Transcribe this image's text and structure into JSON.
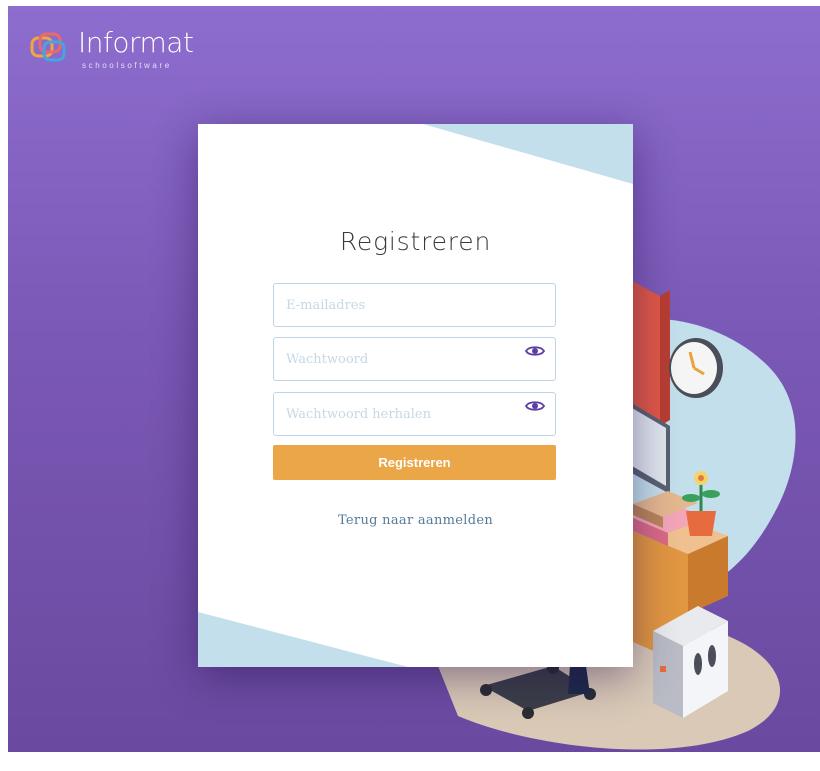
{
  "brand": {
    "name": "Informat",
    "tagline": "schoolsoftware"
  },
  "form": {
    "title": "Registreren",
    "email_placeholder": "E-mailadres",
    "password_placeholder": "Wachtwoord",
    "password_repeat_placeholder": "Wachtwoord herhalen",
    "submit_label": "Registreren",
    "back_link": "Terug naar aanmelden"
  },
  "icons": {
    "password_toggle": "eye-icon",
    "password_repeat_toggle": "eye-icon"
  },
  "colors": {
    "background": "#7a58b5",
    "accent_button": "#eaa647",
    "link": "#557a99",
    "input_border": "#bfd6e6",
    "card_decoration": "#c3dfec",
    "icon_purple": "#5b3fa6"
  }
}
